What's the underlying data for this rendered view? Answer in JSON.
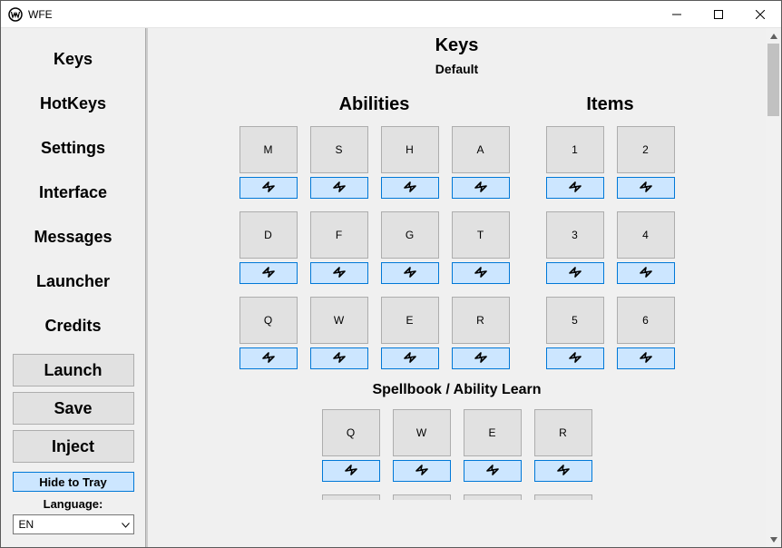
{
  "window": {
    "title": "WFE"
  },
  "sidebar": {
    "nav": [
      "Keys",
      "HotKeys",
      "Settings",
      "Interface",
      "Messages",
      "Launcher",
      "Credits"
    ],
    "buttons": {
      "launch": "Launch",
      "save": "Save",
      "inject": "Inject"
    },
    "tray": "Hide to Tray",
    "language_label": "Language:",
    "language_value": "EN"
  },
  "page": {
    "title": "Keys",
    "subtitle": "Default",
    "abilities": {
      "title": "Abilities",
      "rows": [
        [
          "M",
          "S",
          "H",
          "A"
        ],
        [
          "D",
          "F",
          "G",
          "T"
        ],
        [
          "Q",
          "W",
          "E",
          "R"
        ]
      ]
    },
    "items": {
      "title": "Items",
      "rows": [
        [
          "1",
          "2"
        ],
        [
          "3",
          "4"
        ],
        [
          "5",
          "6"
        ]
      ]
    },
    "spellbook": {
      "title": "Spellbook / Ability Learn",
      "rows": [
        [
          "Q",
          "W",
          "E",
          "R"
        ],
        [
          "",
          "",
          "",
          ""
        ]
      ]
    }
  }
}
